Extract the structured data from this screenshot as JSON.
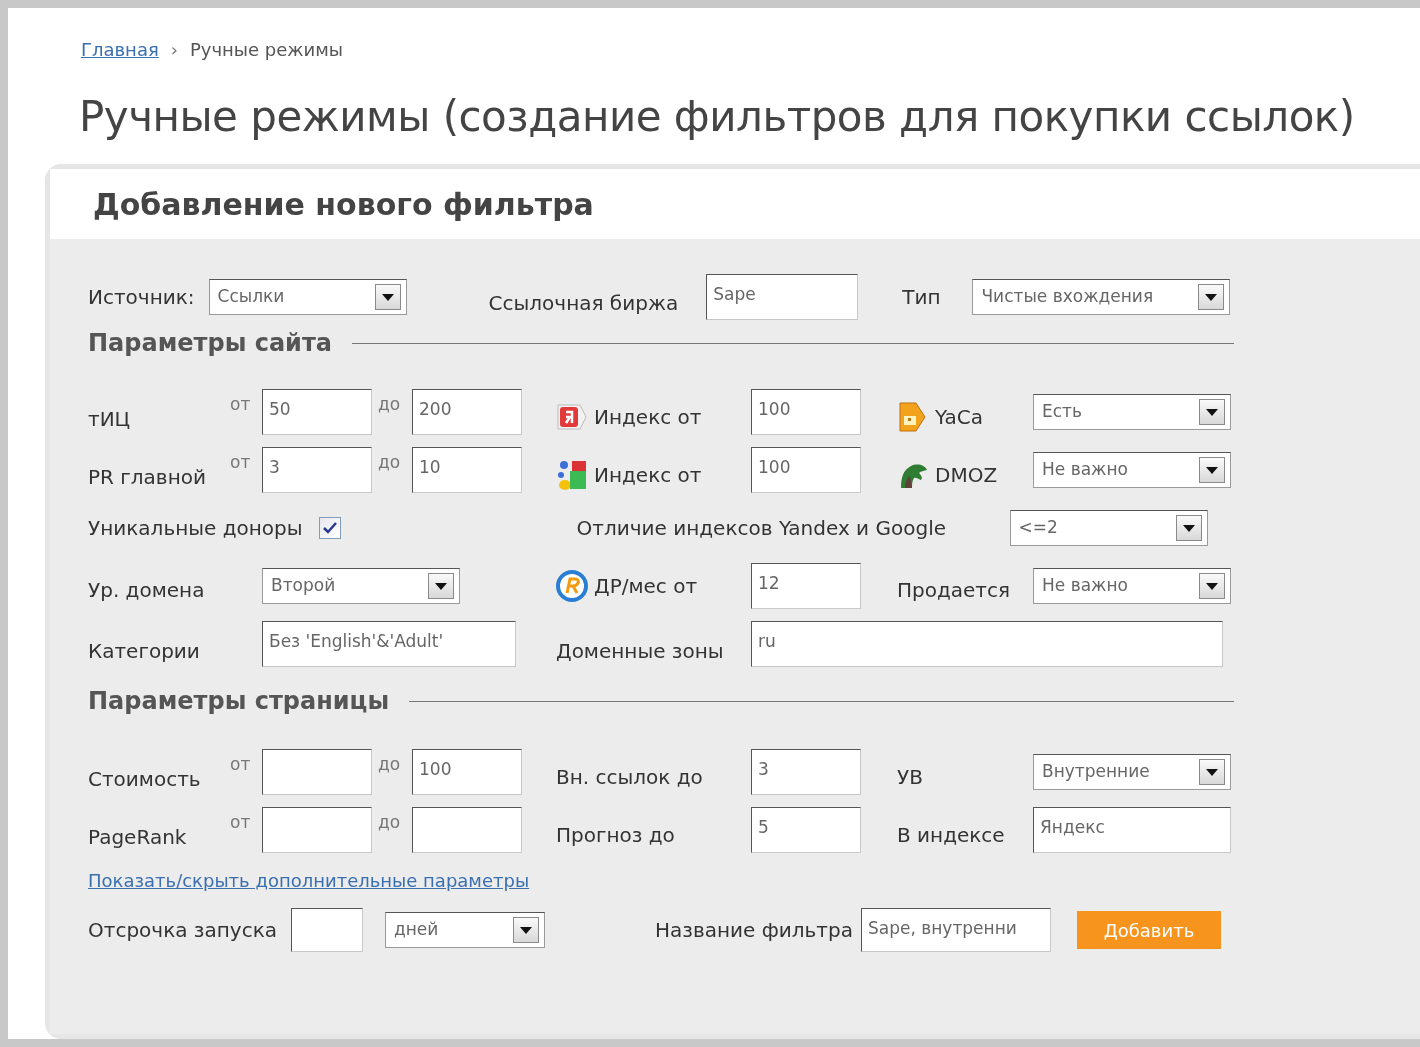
{
  "breadcrumb": {
    "items": [
      {
        "label": "Главная",
        "kind": "link"
      },
      {
        "label": "Ручные режимы",
        "kind": "current"
      }
    ],
    "separator": "›"
  },
  "title": "Ручные режимы (создание фильтров для покупки ссылок)",
  "panel": {
    "title": "Добавление нового фильтра",
    "top": [
      {
        "label": "Источник:",
        "kind": "select",
        "value": "Ссылки"
      },
      {
        "label": "Ссылочная биржа",
        "kind": "input",
        "value": "Sape"
      },
      {
        "label": "Тип",
        "kind": "select",
        "value": "Чистые вхождения"
      }
    ],
    "site_section": {
      "title": "Параметры сайта",
      "range_rows": [
        {
          "label": "тИЦ",
          "from_label": "от",
          "from": "50",
          "to_label": "до",
          "to": "200",
          "mid_label": "Индекс от",
          "mid_value": "100",
          "right": {
            "label": "YaCa",
            "kind": "select",
            "value": "Есть"
          }
        },
        {
          "label": "PR главной",
          "from_label": "от",
          "from": "3",
          "to_label": "до",
          "to": "10",
          "mid_label": "Индекс от",
          "mid_value": "100",
          "right": {
            "label": "DMOZ",
            "kind": "select",
            "value": "Не важно"
          }
        }
      ],
      "unique_donors": {
        "label": "Уникальные доноры",
        "checked": true
      },
      "index_diff": {
        "label": "Отличие индексов Yandex и Google",
        "value": "<=2"
      },
      "domain_level": {
        "label": "Ур. домена",
        "value": "Второй"
      },
      "dr": {
        "label": "ДР/мес от",
        "value": "12"
      },
      "for_sale": {
        "label": "Продается",
        "value": "Не важно"
      },
      "categories": {
        "label": "Категории",
        "value": "Без 'English'&'Adult'"
      },
      "zones": {
        "label": "Доменные зоны",
        "value": "ru"
      }
    },
    "page_section": {
      "title": "Параметры страницы",
      "range_rows": [
        {
          "label": "Стоимость",
          "from_label": "от",
          "to_label": "до",
          "to": "100",
          "mid_label": "Вн. ссылок до",
          "mid_value": "3",
          "right": {
            "label": "УВ",
            "kind": "select",
            "value": "Внутренние"
          }
        },
        {
          "label": "PageRank",
          "from_label": "от",
          "to_label": "до",
          "mid_label": "Прогноз до",
          "mid_value": "5",
          "right": {
            "label": "В индексе",
            "kind": "input",
            "value": "Яндекс"
          }
        }
      ]
    },
    "toggle_link": "Показать/скрыть дополнительные параметры",
    "delay": {
      "label": "Отсрочка запуска",
      "unit": "дней"
    },
    "filter_name": {
      "label": "Название фильтра",
      "value": "Sape, внутренни"
    },
    "submit": "Добавить"
  }
}
